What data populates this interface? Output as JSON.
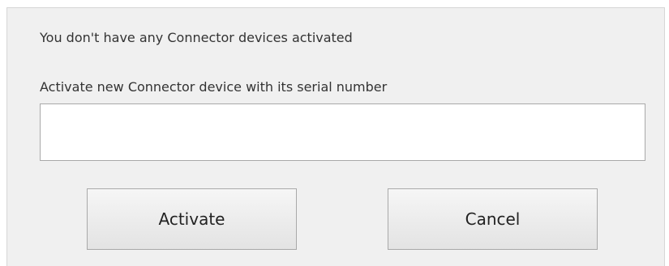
{
  "dialog": {
    "status_text": "You don't have any Connector devices activated",
    "field_label": "Activate new Connector device with its serial number",
    "serial_input": {
      "value": "",
      "placeholder": ""
    },
    "activate_label": "Activate",
    "cancel_label": "Cancel"
  },
  "colors": {
    "dialog_background": "#f0f0f0",
    "input_background": "#ffffff",
    "border": "#a9a9a9",
    "text": "#333333"
  }
}
